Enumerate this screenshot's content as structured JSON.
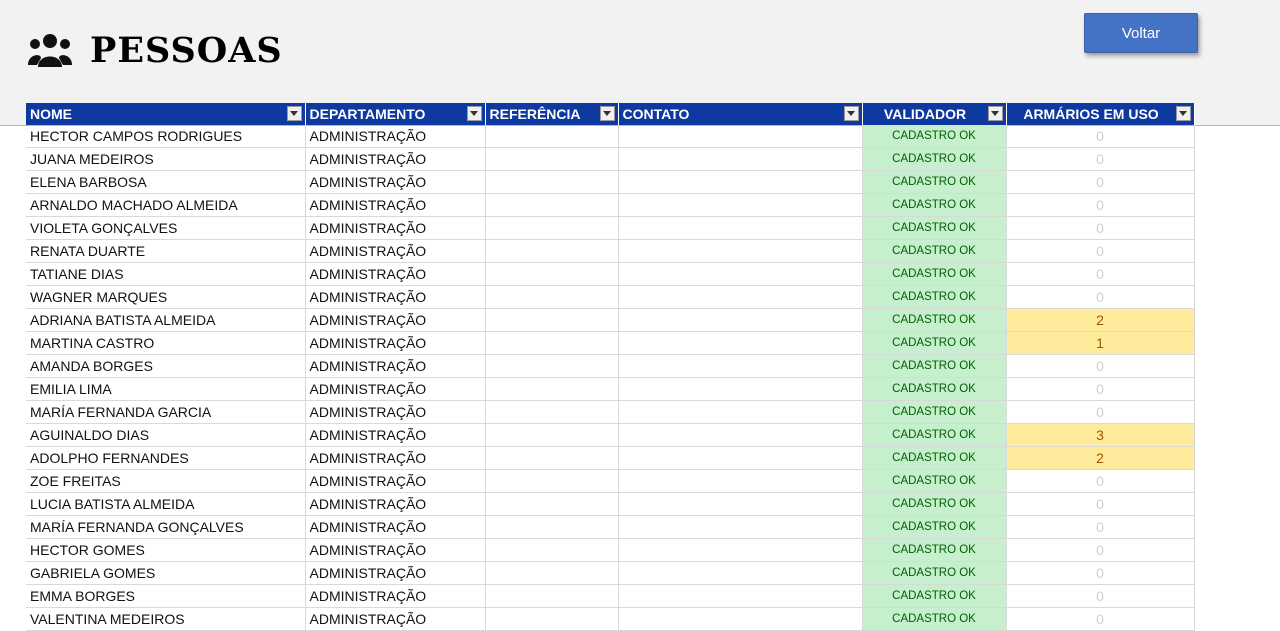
{
  "page": {
    "title": "PESSOAS",
    "title_icon": "users-icon",
    "back_label": "Voltar"
  },
  "colors": {
    "header_band": "#f2f2f2",
    "table_header": "#0e39a0",
    "button": "#4472c4",
    "validator_fill": "#c6efce",
    "validator_text": "#006100",
    "inuse_fill": "#ffeb9c",
    "inuse_text": "#9c5700"
  },
  "table": {
    "columns": [
      "NOME",
      "DEPARTAMENTO",
      "REFERÊNCIA",
      "CONTATO",
      "VALIDADOR",
      "ARMÁRIOS EM USO"
    ],
    "rows": [
      {
        "name": "HECTOR CAMPOS RODRIGUES",
        "department": "ADMINISTRAÇÃO",
        "reference": "",
        "contact": "",
        "validator": "CADASTRO OK",
        "lockers": "0"
      },
      {
        "name": "JUANA MEDEIROS",
        "department": "ADMINISTRAÇÃO",
        "reference": "",
        "contact": "",
        "validator": "CADASTRO OK",
        "lockers": "0"
      },
      {
        "name": "ELENA BARBOSA",
        "department": "ADMINISTRAÇÃO",
        "reference": "",
        "contact": "",
        "validator": "CADASTRO OK",
        "lockers": "0"
      },
      {
        "name": "ARNALDO MACHADO ALMEIDA",
        "department": "ADMINISTRAÇÃO",
        "reference": "",
        "contact": "",
        "validator": "CADASTRO OK",
        "lockers": "0"
      },
      {
        "name": "VIOLETA GONÇALVES",
        "department": "ADMINISTRAÇÃO",
        "reference": "",
        "contact": "",
        "validator": "CADASTRO OK",
        "lockers": "0"
      },
      {
        "name": "RENATA DUARTE",
        "department": "ADMINISTRAÇÃO",
        "reference": "",
        "contact": "",
        "validator": "CADASTRO OK",
        "lockers": "0"
      },
      {
        "name": "TATIANE DIAS",
        "department": "ADMINISTRAÇÃO",
        "reference": "",
        "contact": "",
        "validator": "CADASTRO OK",
        "lockers": "0"
      },
      {
        "name": "WAGNER MARQUES",
        "department": "ADMINISTRAÇÃO",
        "reference": "",
        "contact": "",
        "validator": "CADASTRO OK",
        "lockers": "0"
      },
      {
        "name": "ADRIANA BATISTA ALMEIDA",
        "department": "ADMINISTRAÇÃO",
        "reference": "",
        "contact": "",
        "validator": "CADASTRO OK",
        "lockers": "2"
      },
      {
        "name": "MARTINA CASTRO",
        "department": "ADMINISTRAÇÃO",
        "reference": "",
        "contact": "",
        "validator": "CADASTRO OK",
        "lockers": "1"
      },
      {
        "name": "AMANDA BORGES",
        "department": "ADMINISTRAÇÃO",
        "reference": "",
        "contact": "",
        "validator": "CADASTRO OK",
        "lockers": "0"
      },
      {
        "name": "EMILIA LIMA",
        "department": "ADMINISTRAÇÃO",
        "reference": "",
        "contact": "",
        "validator": "CADASTRO OK",
        "lockers": "0"
      },
      {
        "name": "MARÍA FERNANDA GARCIA",
        "department": "ADMINISTRAÇÃO",
        "reference": "",
        "contact": "",
        "validator": "CADASTRO OK",
        "lockers": "0"
      },
      {
        "name": "AGUINALDO DIAS",
        "department": "ADMINISTRAÇÃO",
        "reference": "",
        "contact": "",
        "validator": "CADASTRO OK",
        "lockers": "3"
      },
      {
        "name": "ADOLPHO FERNANDES",
        "department": "ADMINISTRAÇÃO",
        "reference": "",
        "contact": "",
        "validator": "CADASTRO OK",
        "lockers": "2"
      },
      {
        "name": "ZOE FREITAS",
        "department": "ADMINISTRAÇÃO",
        "reference": "",
        "contact": "",
        "validator": "CADASTRO OK",
        "lockers": "0"
      },
      {
        "name": "LUCIA BATISTA ALMEIDA",
        "department": "ADMINISTRAÇÃO",
        "reference": "",
        "contact": "",
        "validator": "CADASTRO OK",
        "lockers": "0"
      },
      {
        "name": "MARÍA FERNANDA GONÇALVES",
        "department": "ADMINISTRAÇÃO",
        "reference": "",
        "contact": "",
        "validator": "CADASTRO OK",
        "lockers": "0"
      },
      {
        "name": "HECTOR GOMES",
        "department": "ADMINISTRAÇÃO",
        "reference": "",
        "contact": "",
        "validator": "CADASTRO OK",
        "lockers": "0"
      },
      {
        "name": "GABRIELA GOMES",
        "department": "ADMINISTRAÇÃO",
        "reference": "",
        "contact": "",
        "validator": "CADASTRO OK",
        "lockers": "0"
      },
      {
        "name": "EMMA BORGES",
        "department": "ADMINISTRAÇÃO",
        "reference": "",
        "contact": "",
        "validator": "CADASTRO OK",
        "lockers": "0"
      },
      {
        "name": "VALENTINA MEDEIROS",
        "department": "ADMINISTRAÇÃO",
        "reference": "",
        "contact": "",
        "validator": "CADASTRO OK",
        "lockers": "0"
      }
    ]
  }
}
